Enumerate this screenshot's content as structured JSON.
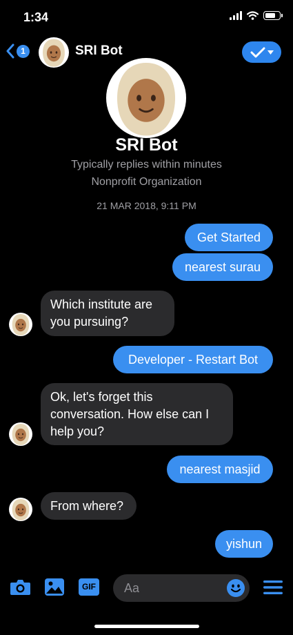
{
  "status": {
    "time": "1:34",
    "battery_level": 0.85
  },
  "header": {
    "unread_count": "1",
    "title": "SRI Bot"
  },
  "profile": {
    "name": "SRI Bot",
    "reply_time": "Typically replies within minutes",
    "category": "Nonprofit Organization"
  },
  "conversation": {
    "date": "21 MAR 2018, 9:11 PM",
    "messages": [
      {
        "from": "user",
        "text": "Get Started"
      },
      {
        "from": "user",
        "text": "nearest surau"
      },
      {
        "from": "bot",
        "lines": [
          "Which institute are",
          "you pursuing?"
        ]
      },
      {
        "from": "user",
        "text": "Developer - Restart Bot"
      },
      {
        "from": "bot",
        "lines": [
          "Ok, let's forget this",
          "conversation. How else can I",
          "help you?"
        ]
      },
      {
        "from": "user",
        "text": "nearest masjid"
      },
      {
        "from": "bot",
        "lines": [
          "From where?"
        ]
      },
      {
        "from": "user",
        "text": "yishun"
      }
    ]
  },
  "composer": {
    "placeholder": "Aa",
    "gif_label": "GIF",
    "icons": [
      "camera-icon",
      "photo-icon",
      "gif-icon",
      "emoji-icon",
      "menu-icon"
    ]
  },
  "colors": {
    "accent": "#3a8ff0",
    "incoming_bubble": "#2b2b2d",
    "background": "#000000",
    "muted_text": "#a0a0a5"
  }
}
